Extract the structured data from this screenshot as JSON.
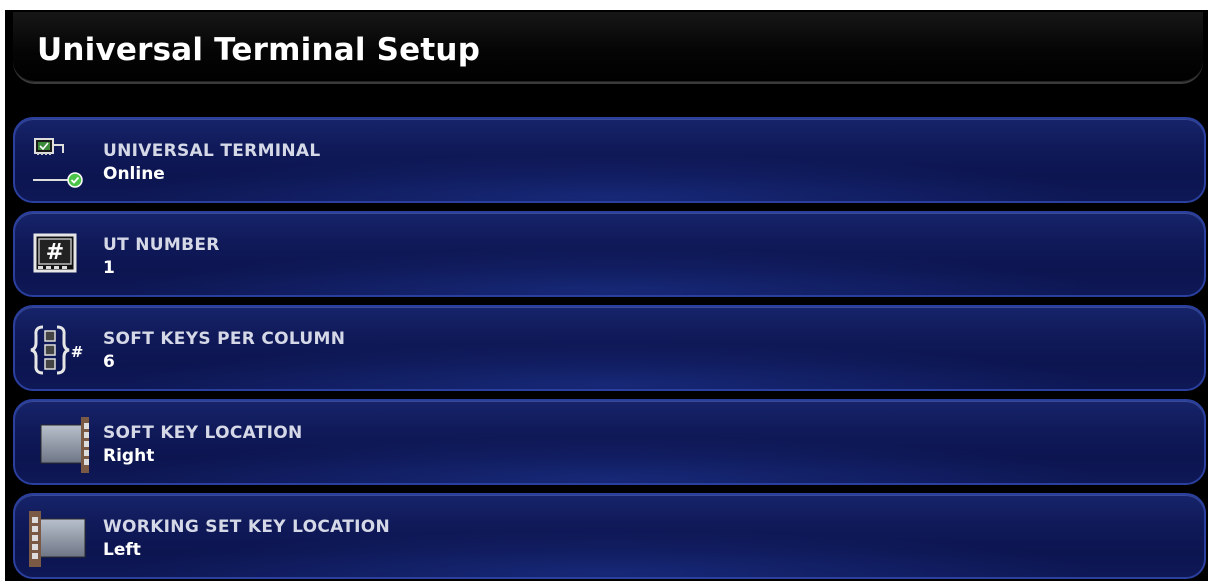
{
  "title": "Universal Terminal Setup",
  "rows": [
    {
      "label": "UNIVERSAL TERMINAL",
      "value": "Online",
      "icon": "terminal-online-icon"
    },
    {
      "label": "UT NUMBER",
      "value": "1",
      "icon": "number-hash-icon"
    },
    {
      "label": "SOFT KEYS PER COLUMN",
      "value": "6",
      "icon": "keys-per-column-icon"
    },
    {
      "label": "SOFT KEY LOCATION",
      "value": "Right",
      "icon": "soft-key-location-icon"
    },
    {
      "label": "WORKING SET KEY LOCATION",
      "value": "Left",
      "icon": "working-set-key-location-icon"
    }
  ],
  "icon_glyphs": {
    "hash": "#",
    "hash_small": "#"
  },
  "colors": {
    "row_bg": "#101a5a",
    "row_border": "#2b3f9e",
    "title_bg": "#0a0a0a",
    "ok_green": "#4cc44a",
    "key_bronze": "#8a6a52"
  }
}
